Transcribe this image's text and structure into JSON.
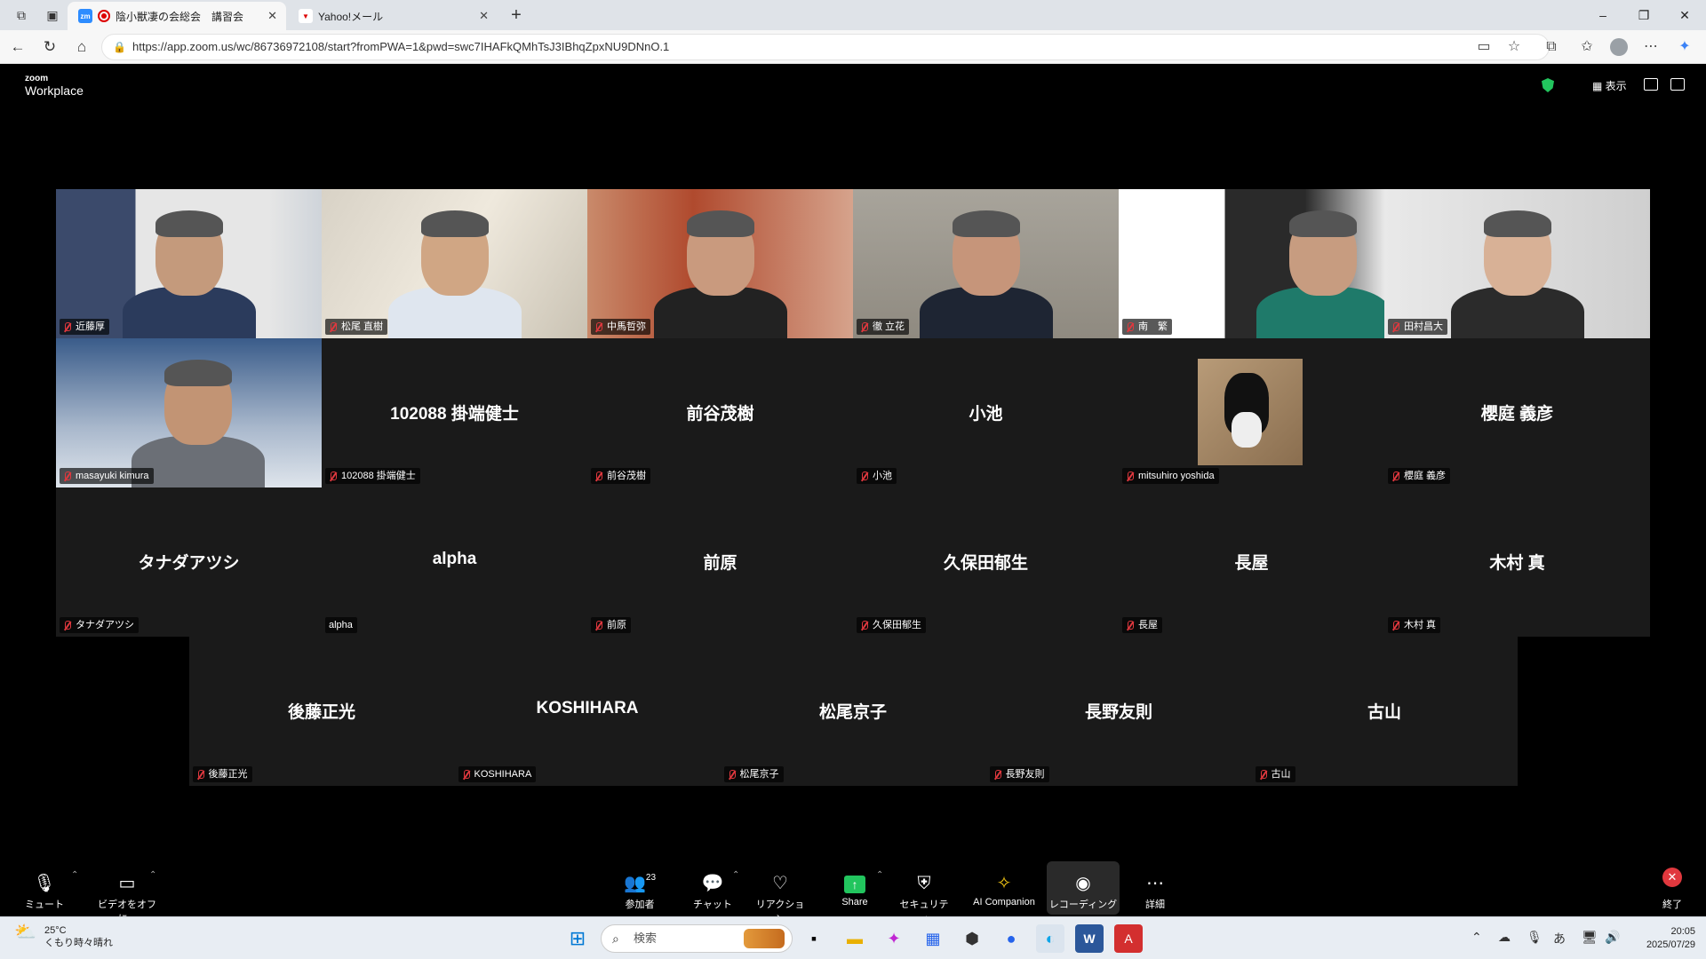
{
  "browser": {
    "tabs": [
      {
        "title": "陰小獣凄の会総会　講習会",
        "active": true
      },
      {
        "title": "Yahoo!メール",
        "active": false
      }
    ],
    "url": "https://app.zoom.us/wc/86736972108/start?fromPWA=1&pwd=swc7IHAFkQMhTsJ3IBhqZpxNU9DNnO.1"
  },
  "zoom": {
    "logo_small": "zoom",
    "logo_big": "Workplace",
    "view_label": "表示"
  },
  "participants": [
    {
      "name": "近藤厚",
      "video": true
    },
    {
      "name": "松尾 直樹",
      "video": true
    },
    {
      "name": "中馬哲弥",
      "video": true
    },
    {
      "name": "徹 立花",
      "video": true,
      "speaking": true
    },
    {
      "name": "南　繁",
      "video": true
    },
    {
      "name": "田村昌大",
      "video": true
    },
    {
      "name": "masayuki kimura",
      "video": true
    },
    {
      "name": "102088 掛端健士",
      "display": "102088 掛端健士",
      "video": false
    },
    {
      "name": "前谷茂樹",
      "display": "前谷茂樹",
      "video": false
    },
    {
      "name": "小池",
      "display": "小池",
      "video": false
    },
    {
      "name": "mitsuhiro yoshida",
      "video": false
    },
    {
      "name": "櫻庭 義彦",
      "display": "櫻庭 義彦",
      "video": false
    },
    {
      "name": "タナダアツシ",
      "display": "タナダアツシ",
      "video": false
    },
    {
      "name": "alpha",
      "display": "alpha",
      "video": false
    },
    {
      "name": "前原",
      "display": "前原",
      "video": false
    },
    {
      "name": "久保田郁生",
      "display": "久保田郁生",
      "video": false
    },
    {
      "name": "長屋",
      "display": "長屋",
      "video": false
    },
    {
      "name": "木村 真",
      "display": "木村 真",
      "video": false
    },
    {
      "name": "後藤正光",
      "display": "後藤正光",
      "video": false
    },
    {
      "name": "KOSHIHARA",
      "display": "KOSHIHARA",
      "video": false
    },
    {
      "name": "松尾京子",
      "display": "松尾京子",
      "video": false
    },
    {
      "name": "長野友則",
      "display": "長野友則",
      "video": false
    },
    {
      "name": "古山",
      "display": "古山",
      "video": false
    }
  ],
  "toolbar": {
    "mute": "ミュート",
    "video": "ビデオをオフに...",
    "participants": "参加者",
    "participants_count": "23",
    "chat": "チャット",
    "reaction": "リアクション",
    "share": "Share",
    "security": "セキュリティ",
    "ai": "AI Companion",
    "recording": "レコーディング",
    "more": "詳細",
    "end": "終了"
  },
  "taskbar": {
    "temp": "25°C",
    "weather": "くもり時々晴れ",
    "search_placeholder": "検索",
    "ime": "あ",
    "time": "20:05",
    "date": "2025/07/29"
  }
}
